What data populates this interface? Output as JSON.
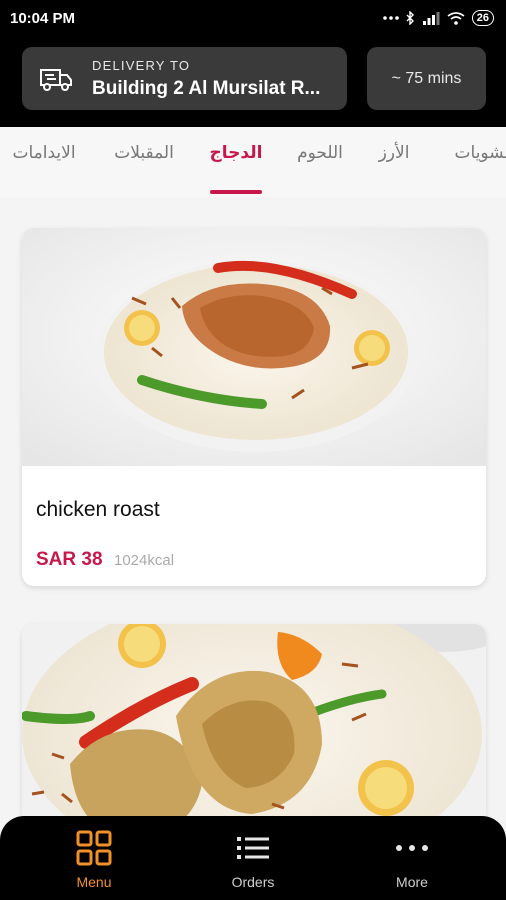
{
  "status_bar": {
    "time": "10:04 PM",
    "battery": "26"
  },
  "header": {
    "delivery_label": "DELIVERY TO",
    "delivery_address": "Building 2 Al Mursilat R...",
    "eta": "~ 75 mins"
  },
  "categories": [
    {
      "label": "مشويات",
      "active": false
    },
    {
      "label": "الأرز",
      "active": false
    },
    {
      "label": "اللحوم",
      "active": false
    },
    {
      "label": "الدجاج",
      "active": true
    },
    {
      "label": "المقبلات",
      "active": false
    },
    {
      "label": "الايدامات",
      "active": false
    }
  ],
  "menu_items": [
    {
      "name": "chicken roast",
      "price": "SAR 38",
      "calories": "1024kcal"
    },
    {
      "name": "",
      "price": "",
      "calories": ""
    }
  ],
  "bottom_nav": [
    {
      "label": "Menu",
      "icon": "grid-icon",
      "active": true
    },
    {
      "label": "Orders",
      "icon": "list-icon",
      "active": false
    },
    {
      "label": "More",
      "icon": "more-dots-icon",
      "active": false
    }
  ],
  "colors": {
    "accent": "#c8174b",
    "nav_active": "#f0912a",
    "header_bg": "#000000",
    "header_box": "#3a3a3a"
  }
}
